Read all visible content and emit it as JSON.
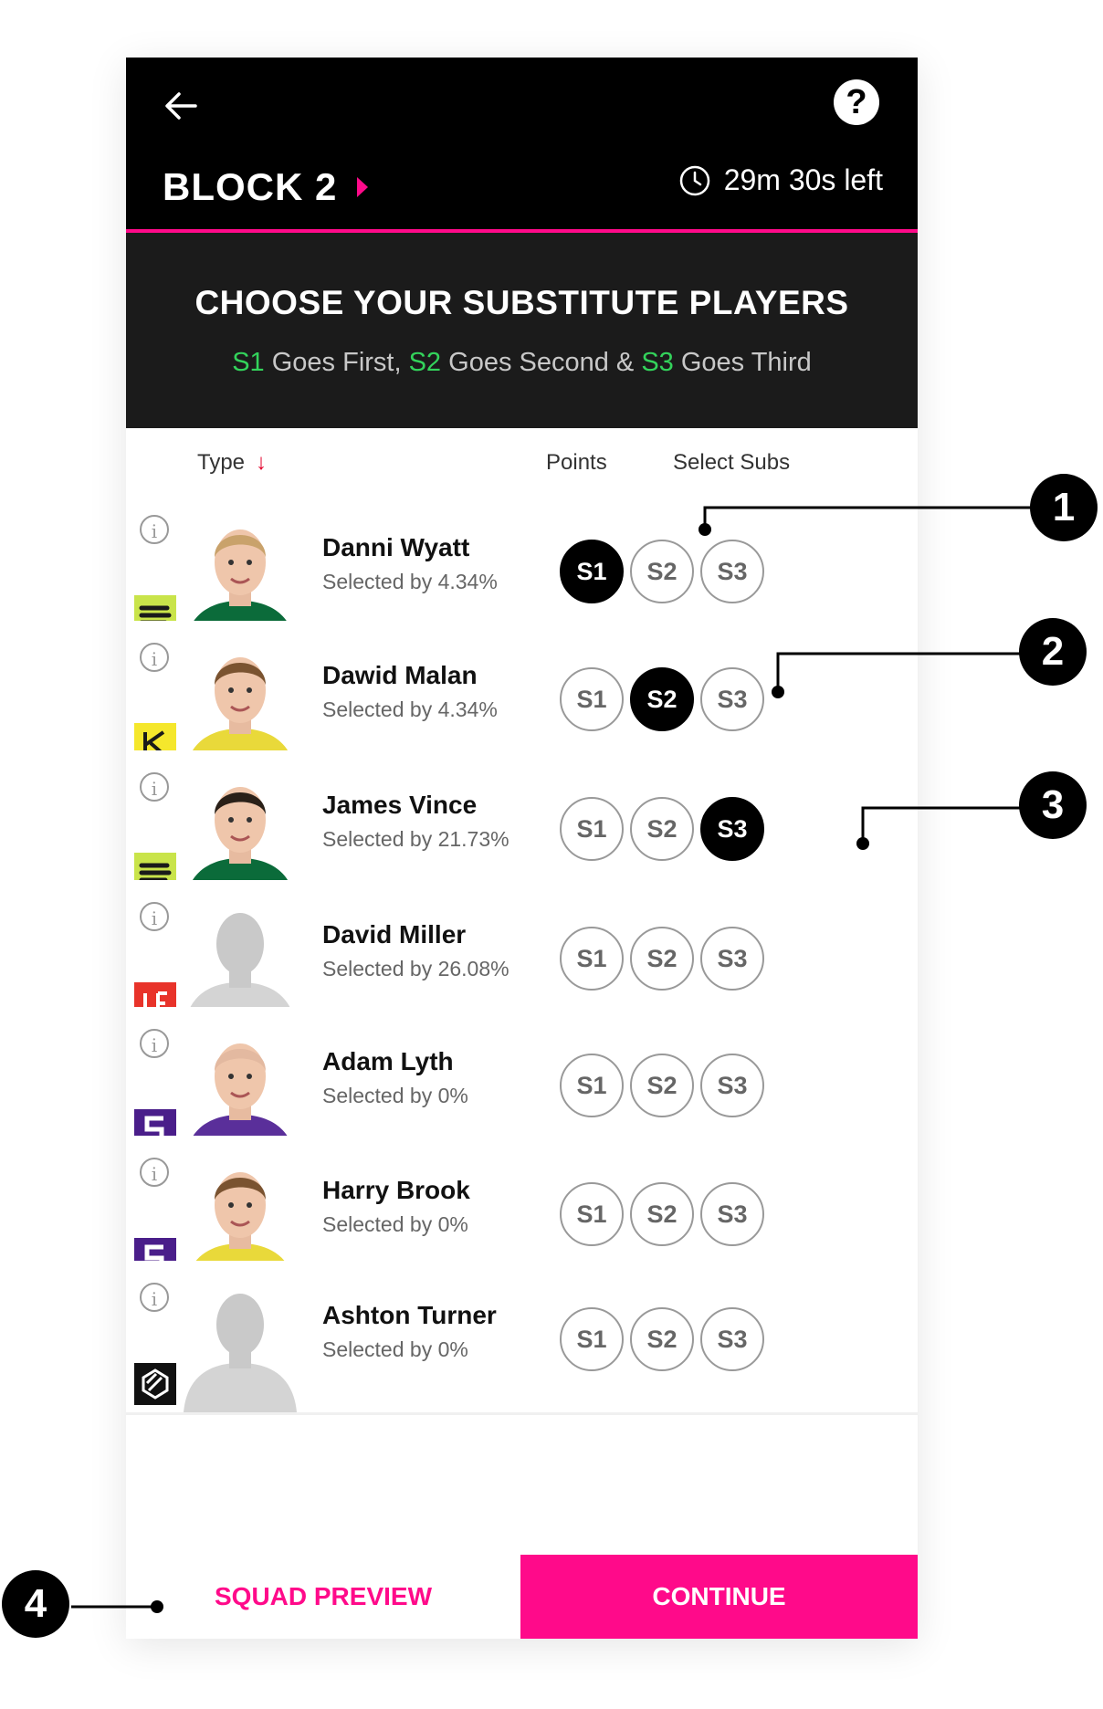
{
  "header": {
    "block_title": "BLOCK 2",
    "timer": "29m 30s left",
    "help_label": "?"
  },
  "banner": {
    "title": "CHOOSE YOUR SUBSTITUTE PLAYERS",
    "s1": "S1",
    "t1": " Goes First, ",
    "s2": "S2",
    "t2": " Goes Second & ",
    "s3": "S3",
    "t3": " Goes Third"
  },
  "columns": {
    "type": "Type",
    "type_sort": "↓",
    "points": "Points",
    "select": "Select Subs"
  },
  "sub_labels": [
    "S1",
    "S2",
    "S3"
  ],
  "players": [
    {
      "name": "Danni Wyatt",
      "selected": "Selected by 4.34%",
      "active": 0,
      "team": "stars",
      "photo": "blonde"
    },
    {
      "name": "Dawid Malan",
      "selected": "Selected by 4.34%",
      "active": 1,
      "team": "heat",
      "photo": "brown"
    },
    {
      "name": "James Vince",
      "selected": "Selected by 21.73%",
      "active": 2,
      "team": "stars",
      "photo": "dark"
    },
    {
      "name": "David Miller",
      "selected": "Selected by 26.08%",
      "active": -1,
      "team": "renegades",
      "photo": "silhouette"
    },
    {
      "name": "Adam Lyth",
      "selected": "Selected by 0%",
      "active": -1,
      "team": "hurricanes",
      "photo": "bald"
    },
    {
      "name": "Harry Brook",
      "selected": "Selected by 0%",
      "active": -1,
      "team": "hurricanes",
      "photo": "brown"
    },
    {
      "name": "Ashton Turner",
      "selected": "Selected by 0%",
      "active": -1,
      "team": "scorchers",
      "photo": "silhouette"
    }
  ],
  "footer": {
    "squad_preview": "SQUAD PREVIEW",
    "continue": "CONTINUE"
  },
  "callouts": [
    "1",
    "2",
    "3",
    "4"
  ],
  "colors": {
    "accent": "#ff0a8a",
    "green": "#33d35b",
    "black": "#000000"
  }
}
